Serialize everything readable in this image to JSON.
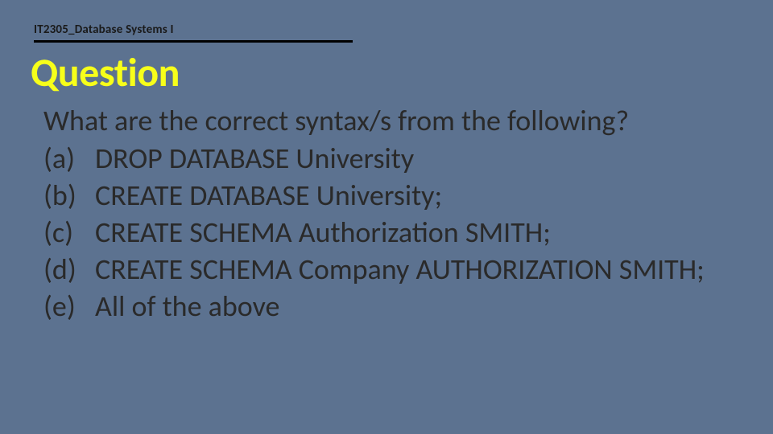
{
  "course": "IT2305_Database Systems I",
  "heading": "Question",
  "question": "What are the correct syntax/s from the following?",
  "options": [
    {
      "letter": "(a)",
      "text": "DROP DATABASE University"
    },
    {
      "letter": "(b)",
      "text": "CREATE DATABASE University;"
    },
    {
      "letter": "(c)",
      "text": "CREATE SCHEMA  Authorization SMITH;"
    },
    {
      "letter": "(d)",
      "text": "CREATE SCHEMA Company AUTHORIZATION SMITH;"
    },
    {
      "letter": "(e)",
      "text": "All of the above"
    }
  ]
}
